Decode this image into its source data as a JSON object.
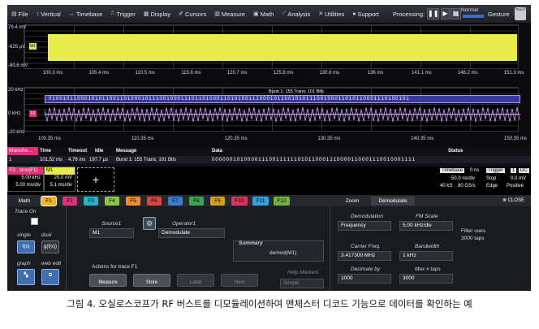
{
  "menubar": {
    "items": [
      {
        "icon": "file-icon",
        "glyph": "▤",
        "label": "File"
      },
      {
        "icon": "vertical-icon",
        "glyph": "↕",
        "label": "Vertical"
      },
      {
        "icon": "timebase-icon",
        "glyph": "↔",
        "label": "Timebase"
      },
      {
        "icon": "trigger-icon",
        "glyph": "⎍",
        "label": "Trigger"
      },
      {
        "icon": "display-icon",
        "glyph": "▦",
        "label": "Display"
      },
      {
        "icon": "cursors-icon",
        "glyph": "✐",
        "label": "Cursors"
      },
      {
        "icon": "measure-icon",
        "glyph": "▥",
        "label": "Measure"
      },
      {
        "icon": "math-icon",
        "glyph": "▣",
        "label": "Math"
      },
      {
        "icon": "analysis-icon",
        "glyph": "⟋",
        "label": "Analysis"
      },
      {
        "icon": "utilities-icon",
        "glyph": "✕",
        "label": "Utilities"
      },
      {
        "icon": "support-icon",
        "glyph": "●",
        "label": "Support"
      }
    ],
    "processing_label": "Processing:",
    "normal_label": "Normal",
    "gesture_label": "Gesture",
    "gesture_icon_text": "Touch"
  },
  "grid1": {
    "y_labels": [
      "79.4 mV",
      "-625 µV",
      "-80.6 mV"
    ],
    "x_labels": [
      "100.3 ms",
      "105.4 ms",
      "110.5 ms",
      "115.6 ms",
      "120.7 ms",
      "125.8 ms",
      "130.9 ms",
      "136 ms",
      "141.1 ms",
      "146.2 ms",
      "151.3 ms"
    ],
    "trace_color": "#e7ec4a",
    "marker": "M1"
  },
  "grid2": {
    "y_labels": [
      "20 kHz",
      "0 kHz",
      "-20 kHz"
    ],
    "x_labels": [
      "100.35 ms",
      "110.35 ms",
      "120.35 ms",
      "130.35 ms",
      "140.35 ms",
      "150.35 ms"
    ],
    "burst_label": "Burst 1: 155 Trans; 101 Bits",
    "decode_bits": "0 1 0 0 1 0 1 1 0 0 0 1 0 1 0 1 1 0 0 1 1 0 1 0 0 0 1 0 1 1 1 0 0 1 0 0 0 1 1 1 0 1 1 0 1 0 0 0 1 1 0 1 0 1 0 0 1 1 1 0 0 0 1 0 1 1 0 0 1 0 1 0 1 1 1 0 0 1 0 0 0 1 1 0 1 0 1 1 0 0 0 1 1 1 0 1 0 0 1 0 1",
    "trace_color": "#c8a0ff",
    "decode_color": "#3a3a9a"
  },
  "decode_table": {
    "tag": "Manche...",
    "headers": [
      "Time",
      "Timeout",
      "Idle",
      "Message",
      "Data",
      "Status"
    ],
    "row": {
      "index": "1",
      "time": "101.52 ms",
      "timeout": "4.76 ms",
      "idle": "197.7 µs",
      "message": "Burst 1: 155 Trans; 101 Bits",
      "data": "0 0 0 0 0 0 1 0 1 0 0 0 0 1 1 1 0 0 1 1 1 1 1 1 0 1 0 1 1 0 0 0 1 1 1 0 0 0 0 1 1 0 0 0 1 1 1 0 0 1 0 0 0 1 1 1 1",
      "status": ""
    }
  },
  "descriptors": {
    "f2": {
      "label": "F2",
      "name": "smo(F1)",
      "v1": "5.00 kHz",
      "v2": "5.00 ms/div",
      "color": "#e0307a"
    },
    "m1": {
      "label": "M1",
      "v1": "20.0 mV",
      "v2": "5.1 ms/div",
      "color": "#e7ec4a"
    },
    "add_symbol": "+",
    "timebase": {
      "head": "Timebase",
      "val": "0 ns",
      "r1a": "50.0 ns/div",
      "r2a": "40 kS",
      "r2b": "80 GS/s"
    },
    "trigger": {
      "head": "Trigger",
      "badge1": "1",
      "badge2": "DC",
      "r1a": "Stop",
      "r1b": "0.0 mV",
      "r2a": "Edge",
      "r2b": "Positive"
    }
  },
  "tabs": {
    "math": "Math",
    "functions": [
      {
        "label": "F1",
        "color": "#f5b323"
      },
      {
        "label": "F2",
        "color": "#e0307a"
      },
      {
        "label": "F3",
        "color": "#23b3c9"
      },
      {
        "label": "F4",
        "color": "#8dc63f"
      },
      {
        "label": "F5",
        "color": "#f08c2a"
      },
      {
        "label": "F6",
        "color": "#e04040"
      },
      {
        "label": "F7",
        "color": "#3a7bd5"
      },
      {
        "label": "F8",
        "color": "#3aa655"
      },
      {
        "label": "F9",
        "color": "#d4a017"
      },
      {
        "label": "F10",
        "color": "#e03060"
      },
      {
        "label": "F11",
        "color": "#30a0e0"
      },
      {
        "label": "F12",
        "color": "#70b040"
      }
    ],
    "zoom": "Zoom",
    "demodulate": "Demodulate",
    "close": "CLOSE"
  },
  "panel": {
    "trace_on": "Trace On",
    "single": "single",
    "dual": "dual",
    "single_btn": "f(x)",
    "dual_btn": "g(f(x))",
    "graph": "graph",
    "web_edit": "web edit",
    "source1_label": "Source1",
    "source1_value": "M1",
    "operator1_label": "Operator1",
    "operator1_value": "Demodulate",
    "actions_label": "Actions for trace F1",
    "measure_btn": "Measure",
    "store_btn": "Store",
    "label_btn": "Label",
    "next_btn": "Next",
    "summary_label": "Summary",
    "summary_value": "demod(M1)",
    "help_markers_label": "Help Markers",
    "help_markers_value": "Simple",
    "demodulation_label": "Demodulation",
    "demodulation_value": "Frequency",
    "fm_scale_label": "FM Scale",
    "fm_scale_value": "5.00 kHz/div",
    "filter_uses": "Filter uses",
    "filter_taps": "3000 taps",
    "carrier_label": "Carrier Freq.",
    "carrier_value": "3.417300 MHz",
    "bandwidth_label": "Bandwidth",
    "bandwidth_value": "1 kHz",
    "decimate_label": "Decimate by",
    "decimate_value": "1000",
    "max_taps_label": "Max # taps",
    "max_taps_value": "3000"
  },
  "caption": "그림 4. 오실로스코프가 RF 버스트를 디모듈레이션하여 맨체스터 디코드 기능으로 데이터를 확인하는 예"
}
